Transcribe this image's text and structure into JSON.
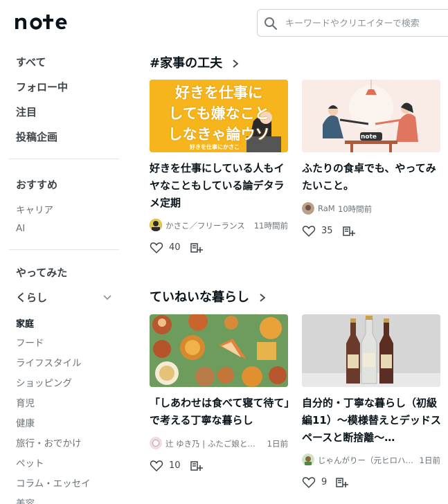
{
  "header": {
    "logo": "note",
    "search": {
      "placeholder": "キーワードやクリエイターで検索"
    }
  },
  "sidebar": {
    "top": [
      "すべて",
      "フォロー中",
      "注目",
      "投稿企画"
    ],
    "recommend_title": "おすすめ",
    "recommend": [
      "キャリア",
      "AI"
    ],
    "yattemita": "やってみた",
    "kurashi": "くらし",
    "kurashi_items": [
      "家庭",
      "フード",
      "ライフスタイル",
      "ショッピング",
      "育児",
      "健康",
      "旅行・おでかけ",
      "ペット",
      "コラム・エッセイ",
      "美容"
    ]
  },
  "sections": [
    {
      "title": "#家事の工夫",
      "cards": [
        {
          "thumb_text": [
            "好きを仕事に",
            "しても嫌なこと",
            "しなきゃ論ウソ"
          ],
          "thumb_sub": "好きを仕事にかさこ",
          "title": "好きを仕事にしている人もイヤなこともしている論デタラメ定期",
          "author": "かさこ／フリーランス",
          "time": "11時間前",
          "likes": "40"
        },
        {
          "thumb_text": [
            "note"
          ],
          "title": "ふたりの食卓でも、やってみたいこと。",
          "author": "RaM",
          "time": "10時間前",
          "likes": "35"
        }
      ]
    },
    {
      "title": "ていねいな暮らし",
      "cards": [
        {
          "title": "「しあわせは食べて寝て待て」で考える丁寧な暮らし",
          "author": "辻 ゆき乃 | ふたご娘との暮らし",
          "time": "1日前",
          "likes": "10"
        },
        {
          "title": "自分的・丁寧な暮らし（初級編11）～模様替えとデッドスペースと断捨離～…",
          "author": "じゃんがりー（元ヒロハ…",
          "time": "1日前",
          "likes": "9"
        }
      ]
    }
  ],
  "colors": {
    "accent": "#08131a",
    "muted": "#6b7378",
    "yellow": "#f6b51c",
    "green": "#6b9a5a"
  }
}
